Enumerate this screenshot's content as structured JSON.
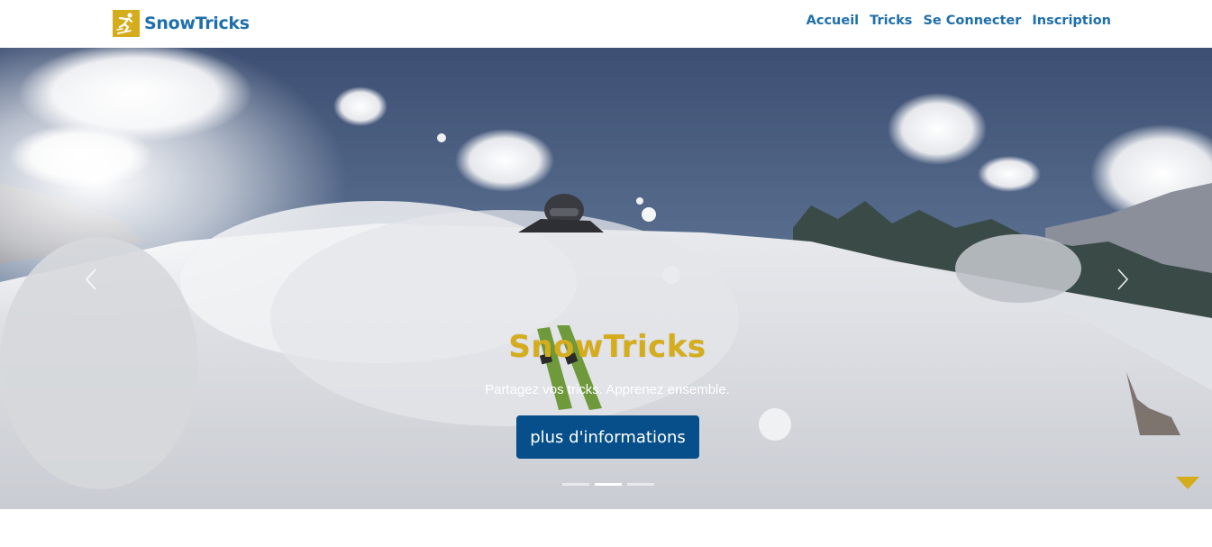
{
  "navbar": {
    "brand": "SnowTricks",
    "logo_icon": "skier-icon",
    "links": [
      "Accueil",
      "Tricks",
      "Se Connecter",
      "Inscription"
    ]
  },
  "hero": {
    "title": "SnowTricks",
    "subtitle": "Partagez vos tricks. Apprenez ensemble.",
    "button_label": "plus d'informations",
    "slides_count": 3,
    "active_slide": 2,
    "prev_icon": "chevron-left-icon",
    "next_icon": "chevron-right-icon",
    "scroll_icon": "caret-down-icon"
  },
  "colors": {
    "brand_blue": "#1f6fad",
    "accent_gold": "#d4ac1c",
    "button_blue": "#074f8a"
  }
}
